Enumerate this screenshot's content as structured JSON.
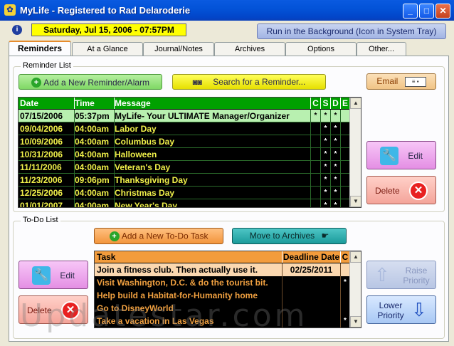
{
  "window": {
    "title": "MyLife - Registered to Rad Delaroderie"
  },
  "header": {
    "date_time": "Saturday, Jul 15, 2006 - 07:57PM",
    "background_button": "Run in the Background (Icon in System Tray)"
  },
  "tabs": [
    "Reminders",
    "At a Glance",
    "Journal/Notes",
    "Archives",
    "Options",
    "Other..."
  ],
  "reminders": {
    "group_label": "Reminder List",
    "add_button": "Add a New Reminder/Alarm",
    "search_button": "Search for a Reminder...",
    "email_button": "Email",
    "edit_button": "Edit",
    "delete_button": "Delete",
    "columns": [
      "Date",
      "Time",
      "Message",
      "C",
      "S",
      "D",
      "E"
    ],
    "rows": [
      {
        "date": "07/15/2006",
        "time": "05:37pm",
        "message": "MyLife- Your ULTIMATE Manager/Organizer",
        "c": "*",
        "s": "*",
        "d": "*",
        "e": ""
      },
      {
        "date": "09/04/2006",
        "time": "04:00am",
        "message": "Labor Day",
        "c": "",
        "s": "*",
        "d": "*",
        "e": ""
      },
      {
        "date": "10/09/2006",
        "time": "04:00am",
        "message": "Columbus Day",
        "c": "",
        "s": "*",
        "d": "*",
        "e": ""
      },
      {
        "date": "10/31/2006",
        "time": "04:00am",
        "message": "Halloween",
        "c": "",
        "s": "*",
        "d": "*",
        "e": ""
      },
      {
        "date": "11/11/2006",
        "time": "04:00am",
        "message": "Veteran's Day",
        "c": "",
        "s": "*",
        "d": "*",
        "e": ""
      },
      {
        "date": "11/23/2006",
        "time": "09:06pm",
        "message": "Thanksgiving Day",
        "c": "",
        "s": "*",
        "d": "*",
        "e": ""
      },
      {
        "date": "12/25/2006",
        "time": "04:00am",
        "message": "Christmas Day",
        "c": "",
        "s": "*",
        "d": "*",
        "e": ""
      },
      {
        "date": "01/01/2007",
        "time": "04:00am",
        "message": "New Year's Day",
        "c": "",
        "s": "*",
        "d": "*",
        "e": ""
      }
    ]
  },
  "todo": {
    "group_label": "To-Do List",
    "add_button": "Add a New To-Do Task",
    "archive_button": "Move to Archives",
    "edit_button": "Edit",
    "delete_button": "Delete",
    "raise_button": "Raise Priority",
    "lower_button": "Lower Priority",
    "columns": [
      "Task",
      "Deadline Date",
      "C"
    ],
    "rows": [
      {
        "task": "Join a fitness club.  Then actually use it.",
        "deadline": "02/25/2011",
        "c": ""
      },
      {
        "task": "Visit Washington, D.C. & do the tourist bit.",
        "deadline": "",
        "c": "*"
      },
      {
        "task": "Help build a Habitat-for-Humanity home",
        "deadline": "",
        "c": ""
      },
      {
        "task": "Go to DisneyWorld",
        "deadline": "",
        "c": ""
      },
      {
        "task": "Take a vacation in Las Vegas",
        "deadline": "",
        "c": "*"
      }
    ]
  },
  "watermark": "Updatestar.com"
}
